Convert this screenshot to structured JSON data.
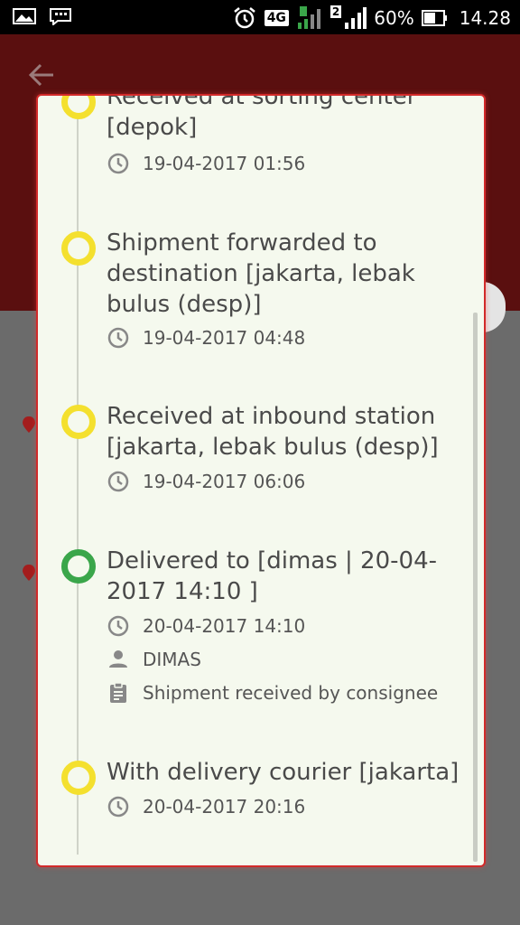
{
  "status_bar": {
    "network": "4G",
    "sim2": "2",
    "battery": "60%",
    "time": "14.28"
  },
  "header": {
    "back_icon": "arrow-left-icon"
  },
  "timeline": [
    {
      "title": "Received at sorting center [depok]",
      "time": "19-04-2017 01:56",
      "status": "yellow"
    },
    {
      "title": "Shipment forwarded to destination [jakarta, lebak bulus (desp)]",
      "time": "19-04-2017 04:48",
      "status": "yellow"
    },
    {
      "title": "Received at inbound station [jakarta, lebak bulus (desp)]",
      "time": "19-04-2017 06:06",
      "status": "yellow"
    },
    {
      "title": "Delivered to [dimas | 20-04-2017 14:10 ]",
      "time": "20-04-2017 14:10",
      "receiver": "DIMAS",
      "note": "Shipment received by consignee",
      "status": "green"
    },
    {
      "title": "With delivery courier [jakarta]",
      "time": "20-04-2017 20:16",
      "status": "yellow"
    }
  ],
  "colors": {
    "header_bg": "#5a0f0f",
    "dialog_border": "#d22a2a",
    "dot_yellow": "#f4e02e",
    "dot_green": "#3aa64a"
  }
}
